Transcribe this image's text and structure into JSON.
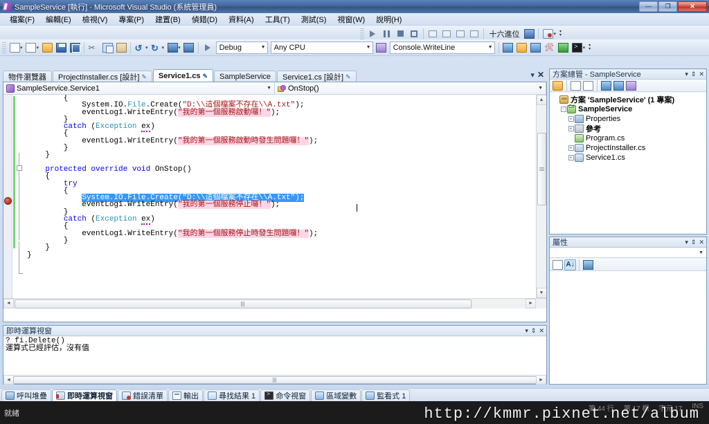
{
  "window": {
    "title": "SampleService [執行] - Microsoft Visual Studio (系統管理員)",
    "minimize_label": "—",
    "maximize_label": "❐",
    "close_label": "✕"
  },
  "menu": {
    "items": [
      {
        "label": "檔案(F)"
      },
      {
        "label": "編輯(E)"
      },
      {
        "label": "檢視(V)"
      },
      {
        "label": "專案(P)"
      },
      {
        "label": "建置(B)"
      },
      {
        "label": "偵錯(D)"
      },
      {
        "label": "資料(A)"
      },
      {
        "label": "工具(T)"
      },
      {
        "label": "測試(S)"
      },
      {
        "label": "視窗(W)"
      },
      {
        "label": "說明(H)"
      }
    ]
  },
  "toolbar_standard": {
    "buttons": [
      {
        "name": "new-project-icon",
        "label": "新增專案"
      },
      {
        "name": "new-item-icon",
        "label": "新增項目"
      },
      {
        "name": "open-file-icon",
        "label": "開啟檔案"
      },
      {
        "name": "save-icon",
        "label": "儲存"
      },
      {
        "name": "save-all-icon",
        "label": "全部儲存"
      },
      {
        "name": "cut-icon",
        "label": "剪下"
      },
      {
        "name": "copy-icon",
        "label": "複製"
      },
      {
        "name": "paste-icon",
        "label": "貼上"
      },
      {
        "name": "undo-icon",
        "label": "復原"
      },
      {
        "name": "redo-icon",
        "label": "取消復原"
      },
      {
        "name": "navigate-backward-icon",
        "label": "向後巡覽"
      },
      {
        "name": "navigate-forward-icon",
        "label": "向前巡覽"
      },
      {
        "name": "start-debug-icon",
        "label": "開始偵錯"
      }
    ],
    "configuration": {
      "value": "Debug",
      "placeholder": "Debug"
    },
    "platform": {
      "value": "Any CPU",
      "placeholder": "Any CPU"
    }
  },
  "toolbar_debug": {
    "buttons": [
      {
        "name": "continue-icon",
        "label": "繼續"
      },
      {
        "name": "break-all-icon",
        "label": "全部中斷"
      },
      {
        "name": "stop-debugging-icon",
        "label": "停止偵錯"
      },
      {
        "name": "restart-icon",
        "label": "重新啟動"
      },
      {
        "name": "show-next-statement-icon",
        "label": "顯示下一個陳述式"
      },
      {
        "name": "step-into-icon",
        "label": "逐步執行"
      },
      {
        "name": "step-over-icon",
        "label": "不進入函式"
      },
      {
        "name": "step-out-icon",
        "label": "跳離函式"
      }
    ],
    "hex_label": "十六進位",
    "thread_label": "執行緒",
    "breakpoint_label": "中斷點"
  },
  "toolbar_find": {
    "search_value": "Console.WriteLine",
    "search_placeholder": "在檔案中尋找",
    "buttons": [
      {
        "name": "quick-find-icon",
        "label": "快速尋找"
      },
      {
        "name": "find-in-files-icon",
        "label": "在檔案中尋找"
      },
      {
        "name": "find-symbol-icon",
        "label": "尋找符號"
      },
      {
        "name": "tools-icon",
        "label": "工具"
      },
      {
        "name": "run-icon",
        "label": "執行"
      },
      {
        "name": "command-window-icon",
        "label": "命令視窗"
      }
    ]
  },
  "document_tabs": {
    "tabs": [
      {
        "label": "物件瀏覽器",
        "active": false,
        "dirty": false
      },
      {
        "label": "ProjectInstaller.cs [設計]",
        "active": false,
        "dirty": true
      },
      {
        "label": "Service1.cs",
        "active": true,
        "dirty": true
      },
      {
        "label": "SampleService",
        "active": false,
        "dirty": false
      },
      {
        "label": "Service1.cs [設計]",
        "active": false,
        "dirty": true
      }
    ],
    "dropdown_label": "▾",
    "close_label": "✕"
  },
  "editor": {
    "class_selector": {
      "value": "SampleService.Service1",
      "icon": "class-icon"
    },
    "member_selector": {
      "value": "OnStop()",
      "icon": "method-icon"
    },
    "breakpoint_line_index": 9,
    "lines": [
      {
        "indent": 0,
        "tokens": [
          {
            "t": "        {",
            "c": ""
          }
        ]
      },
      {
        "indent": 0,
        "tokens": [
          {
            "t": "            System.IO.",
            "c": ""
          },
          {
            "t": "File",
            "c": "t"
          },
          {
            "t": ".Create(",
            "c": ""
          },
          {
            "t": "\"D:\\\\這個檔案不存在\\\\A.txt\"",
            "c": "s"
          },
          {
            "t": ");",
            "c": ""
          }
        ]
      },
      {
        "indent": 0,
        "tokens": [
          {
            "t": "            eventLog1.WriteEntry(",
            "c": ""
          },
          {
            "t": "\"我的第一個服務啟動囉！\"",
            "c": "s hl"
          },
          {
            "t": ");",
            "c": ""
          }
        ]
      },
      {
        "indent": 0,
        "tokens": [
          {
            "t": "        }",
            "c": ""
          }
        ]
      },
      {
        "indent": 0,
        "tokens": [
          {
            "t": "        ",
            "c": ""
          },
          {
            "t": "catch",
            "c": "k"
          },
          {
            "t": " (",
            "c": ""
          },
          {
            "t": "Exception",
            "c": "t"
          },
          {
            "t": " ",
            "c": ""
          },
          {
            "t": "ex",
            "c": "err"
          },
          {
            "t": ")",
            "c": ""
          }
        ]
      },
      {
        "indent": 0,
        "tokens": [
          {
            "t": "        {",
            "c": ""
          }
        ]
      },
      {
        "indent": 0,
        "tokens": [
          {
            "t": "            eventLog1.WriteEntry(",
            "c": ""
          },
          {
            "t": "\"我的第一個服務啟動時發生問題囉！\"",
            "c": "s hl"
          },
          {
            "t": ");",
            "c": ""
          }
        ]
      },
      {
        "indent": 0,
        "tokens": [
          {
            "t": "        }",
            "c": ""
          }
        ]
      },
      {
        "indent": 0,
        "tokens": [
          {
            "t": "    }",
            "c": ""
          }
        ]
      },
      {
        "indent": 0,
        "tokens": [
          {
            "t": "",
            "c": ""
          }
        ]
      },
      {
        "indent": 0,
        "tokens": [
          {
            "t": "    ",
            "c": ""
          },
          {
            "t": "protected override void",
            "c": "k"
          },
          {
            "t": " OnStop()",
            "c": ""
          }
        ]
      },
      {
        "indent": 0,
        "tokens": [
          {
            "t": "    {",
            "c": ""
          }
        ]
      },
      {
        "indent": 0,
        "tokens": [
          {
            "t": "        ",
            "c": ""
          },
          {
            "t": "try",
            "c": "k"
          }
        ]
      },
      {
        "indent": 0,
        "tokens": [
          {
            "t": "        {",
            "c": ""
          }
        ]
      },
      {
        "indent": 0,
        "tokens": [
          {
            "t": "            ",
            "c": ""
          },
          {
            "t": "System.IO.File.Create(\"D:\\\\這個檔案不存在\\\\A.txt\");",
            "c": "sel"
          }
        ]
      },
      {
        "indent": 0,
        "tokens": [
          {
            "t": "            eventLog1.WriteEntry(",
            "c": ""
          },
          {
            "t": "\"我的第一個服務停止囉！\"",
            "c": "s hl"
          },
          {
            "t": ");",
            "c": ""
          }
        ]
      },
      {
        "indent": 0,
        "tokens": [
          {
            "t": "        }",
            "c": ""
          }
        ]
      },
      {
        "indent": 0,
        "tokens": [
          {
            "t": "        ",
            "c": ""
          },
          {
            "t": "catch",
            "c": "k"
          },
          {
            "t": " (",
            "c": ""
          },
          {
            "t": "Exception",
            "c": "t"
          },
          {
            "t": " ",
            "c": ""
          },
          {
            "t": "ex",
            "c": "err"
          },
          {
            "t": ")",
            "c": ""
          }
        ]
      },
      {
        "indent": 0,
        "tokens": [
          {
            "t": "        {",
            "c": ""
          }
        ]
      },
      {
        "indent": 0,
        "tokens": [
          {
            "t": "            eventLog1.WriteEntry(",
            "c": ""
          },
          {
            "t": "\"我的第一個服務停止時發生問題囉！\"",
            "c": "s hl"
          },
          {
            "t": ");",
            "c": ""
          }
        ]
      },
      {
        "indent": 0,
        "tokens": [
          {
            "t": "        }",
            "c": ""
          }
        ]
      },
      {
        "indent": 0,
        "tokens": [
          {
            "t": "    }",
            "c": ""
          }
        ]
      },
      {
        "indent": 0,
        "tokens": [
          {
            "t": "}",
            "c": ""
          }
        ]
      }
    ],
    "scroll_up_label": "▲",
    "scroll_down_label": "▼",
    "scroll_left_label": "◄",
    "scroll_right_label": "►"
  },
  "solution_explorer": {
    "title": "方案總管 - SampleService",
    "dropdown_label": "▾",
    "pin_label": "⇕",
    "close_label": "✕",
    "toolbar": [
      {
        "name": "properties-icon",
        "label": "屬性"
      },
      {
        "name": "show-all-files-icon",
        "label": "顯示所有檔案"
      },
      {
        "name": "refresh-icon",
        "label": "重新整理"
      },
      {
        "name": "view-code-icon",
        "label": "檢視程式碼"
      },
      {
        "name": "view-designer-icon",
        "label": "檢視設計工具"
      },
      {
        "name": "class-view-icon",
        "label": "類別檢視"
      }
    ],
    "tree": [
      {
        "label": "方案 'SampleService' (1 專案)",
        "depth": 0,
        "expander": "",
        "icon": "solution-icon",
        "bold": true
      },
      {
        "label": "SampleService",
        "depth": 1,
        "expander": "-",
        "icon": "project-icon",
        "bold": true
      },
      {
        "label": "Properties",
        "depth": 2,
        "expander": "+",
        "icon": "properties-folder-icon",
        "bold": false
      },
      {
        "label": "參考",
        "depth": 2,
        "expander": "+",
        "icon": "references-folder-icon",
        "bold": true
      },
      {
        "label": "Program.cs",
        "depth": 2,
        "expander": "",
        "icon": "csharp-file-icon",
        "bold": false
      },
      {
        "label": "ProjectInstaller.cs",
        "depth": 2,
        "expander": "+",
        "icon": "csharp-designer-file-icon",
        "bold": false
      },
      {
        "label": "Service1.cs",
        "depth": 2,
        "expander": "+",
        "icon": "csharp-designer-file-icon",
        "bold": false
      }
    ]
  },
  "properties_panel": {
    "title": "屬性",
    "dropdown_label": "▾",
    "pin_label": "⇕",
    "close_label": "✕",
    "object_value": "",
    "object_dropdown_label": "▾",
    "toolbar": [
      {
        "name": "categorized-icon",
        "label": "分類",
        "selected": false
      },
      {
        "name": "alphabetical-icon",
        "label": "字母順序",
        "selected": true
      },
      {
        "name": "property-pages-icon",
        "label": "屬性頁",
        "selected": false
      }
    ]
  },
  "immediate_window": {
    "title": "即時運算視窗",
    "dropdown_label": "▾",
    "pin_label": "⇕",
    "close_label": "✕",
    "lines": [
      "? fi.Delete()",
      "運算式已經評估，沒有值"
    ]
  },
  "bottom_tabs": [
    {
      "label": "呼叫堆疊",
      "icon": "call-stack-icon",
      "active": false
    },
    {
      "label": "即時運算視窗",
      "icon": "immediate-window-icon",
      "active": true
    },
    {
      "label": "錯誤清單",
      "icon": "error-list-icon",
      "active": false
    },
    {
      "label": "輸出",
      "icon": "output-icon",
      "active": false
    },
    {
      "label": "尋找結果 1",
      "icon": "find-results-icon",
      "active": false
    },
    {
      "label": "命令視窗",
      "icon": "command-window-icon",
      "active": false
    },
    {
      "label": "區域變數",
      "icon": "locals-icon",
      "active": false
    },
    {
      "label": "監看式 1",
      "icon": "watch-icon",
      "active": false
    }
  ],
  "status_bar": {
    "ready": "就緒",
    "line": "第 44 行",
    "column": "第 17 欄",
    "char": "字元 17",
    "ins": "INS"
  },
  "watermark": {
    "text": "http://kmmr.pixnet.net/album"
  },
  "colors": {
    "accent": "#3399ff",
    "keyword": "#0000ff",
    "type": "#2b91af",
    "string": "#a31515",
    "breakpoint": "#c0392b",
    "highlight": "#ffd6e7",
    "change_bar": "#6fd96f"
  }
}
